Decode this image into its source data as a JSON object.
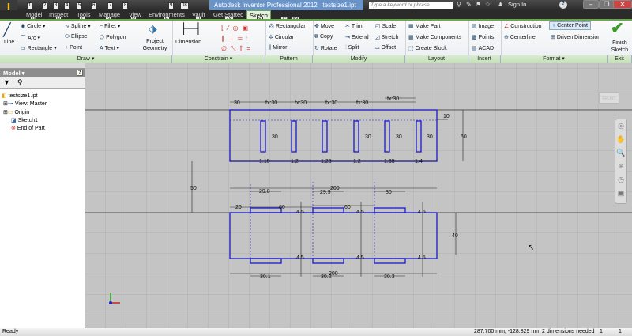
{
  "title_bar": {
    "title": "Autodesk Inventor Professional 2012",
    "filename": "testsize1.ipt",
    "search_placeholder": "Type a keyword or phrase",
    "sign_in": "Sign In",
    "help": "?"
  },
  "tabs": [
    {
      "label": "Model",
      "key": "M"
    },
    {
      "label": "Inspect",
      "key": "N"
    },
    {
      "label": "Tools",
      "key": "T"
    },
    {
      "label": "Manage",
      "key": "G"
    },
    {
      "label": "View",
      "key": "V"
    },
    {
      "label": "Environments",
      "key": "E"
    },
    {
      "label": "Vault",
      "key": "U"
    },
    {
      "label": "Get Started",
      "key": "ZS"
    },
    {
      "label": "Sketch",
      "key": "S"
    }
  ],
  "qat_keys": [
    "1",
    "2",
    "3",
    "4",
    "5",
    "6",
    "7",
    "8",
    "9",
    "08",
    "X2",
    "X3"
  ],
  "ribbon": {
    "draw": {
      "label": "Draw",
      "line": "Line",
      "circle": "Circle",
      "arc": "Arc",
      "rectangle": "Rectangle",
      "spline": "Spline",
      "ellipse": "Ellipse",
      "point": "Point",
      "fillet": "Fillet",
      "polygon": "Polygon",
      "text": "Text",
      "project_geometry": "Project Geometry"
    },
    "constrain": {
      "label": "Constrain",
      "dimension": "Dimension"
    },
    "pattern": {
      "label": "Pattern",
      "rectangular": "Rectangular",
      "circular": "Circular",
      "mirror": "Mirror"
    },
    "modify": {
      "label": "Modify",
      "move": "Move",
      "copy": "Copy",
      "rotate": "Rotate",
      "trim": "Trim",
      "extend": "Extend",
      "split": "Split",
      "scale": "Scale",
      "stretch": "Stretch",
      "offset": "Offset"
    },
    "layout": {
      "label": "Layout",
      "make_part": "Make Part",
      "make_components": "Make Components",
      "create_block": "Create Block"
    },
    "insert": {
      "label": "Insert",
      "image": "Image",
      "points": "Points",
      "acad": "ACAD"
    },
    "format": {
      "label": "Format",
      "construction": "Construction",
      "centerline": "Centerline",
      "center_point": "Center Point",
      "driven_dimension": "Driven Dimension"
    },
    "exit": {
      "label": "Exit",
      "finish_sketch": "Finish Sketch"
    }
  },
  "browser": {
    "title": "Model",
    "items": [
      {
        "label": "testsize1.ipt",
        "icon": "part-icon"
      },
      {
        "label": "View: Master",
        "icon": "view-icon"
      },
      {
        "label": "Origin",
        "icon": "folder-icon"
      },
      {
        "label": "Sketch1",
        "icon": "sketch-icon"
      },
      {
        "label": "End of Part",
        "icon": "end-of-part-icon"
      }
    ]
  },
  "viewcube": "FRONT",
  "sketch": {
    "top_dims": [
      "30",
      "fx:30",
      "fx:30",
      "fx:30",
      "fx:30",
      "fx:30"
    ],
    "slot_heights": [
      "30",
      "30",
      "30",
      "30",
      "30"
    ],
    "slot_gaps": [
      "1.15",
      "1.2",
      "1.25",
      "1.2",
      "1.35",
      "1.4"
    ],
    "right_10": "10",
    "right_50": "50",
    "left_50": "50",
    "width_200a": "200",
    "d29_8": "29.8",
    "d29_9": "29.9",
    "d30": "30",
    "d20": "20",
    "d60a": "60",
    "d60b": "60",
    "d4_5": "4.5",
    "right_40": "40",
    "width_200b": "200",
    "d30_1": "30.1",
    "d30_2": "30.2",
    "d30_3": "30.3"
  },
  "status": {
    "left": "Ready",
    "coords": "287.700 mm, -128.829 mm",
    "needed": "2 dimensions needed",
    "count1": "1",
    "count2": "1"
  },
  "colors": {
    "sketch": "#1a1acc",
    "ribbon_accent": "#6aa84f",
    "title": "#6a93c8"
  }
}
